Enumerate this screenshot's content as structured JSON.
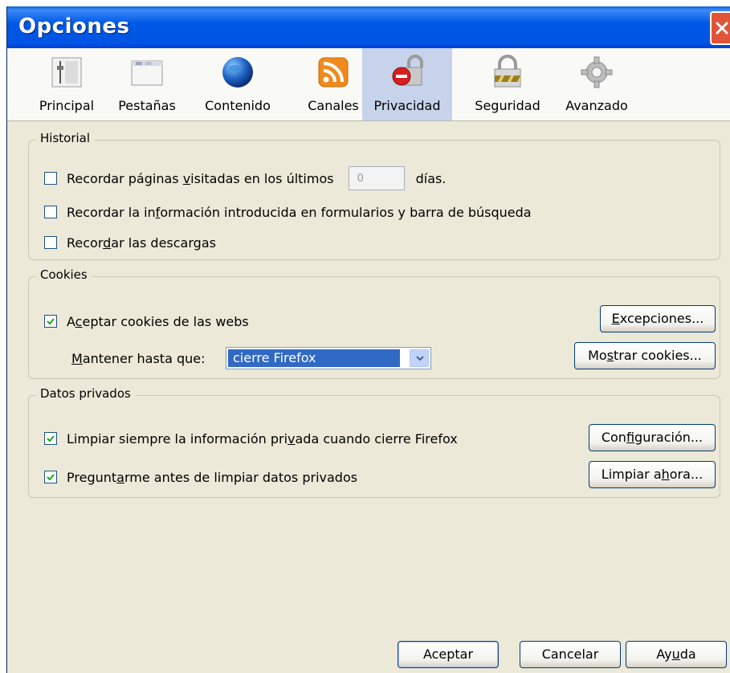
{
  "window": {
    "title": "Opciones"
  },
  "tabs": [
    {
      "label": "Principal",
      "icon": "main-panel-icon",
      "selected": false
    },
    {
      "label": "Pestañas",
      "icon": "tabs-window-icon",
      "selected": false
    },
    {
      "label": "Contenido",
      "icon": "globe-icon",
      "selected": false
    },
    {
      "label": "Canales",
      "icon": "rss-feed-icon",
      "selected": false
    },
    {
      "label": "Privacidad",
      "icon": "privacy-lock-icon",
      "selected": true
    },
    {
      "label": "Seguridad",
      "icon": "security-padlock-icon",
      "selected": false
    },
    {
      "label": "Avanzado",
      "icon": "gear-icon",
      "selected": false
    }
  ],
  "historial": {
    "legend": "Historial",
    "remember_pages": {
      "before": "Recordar páginas ",
      "u": "v",
      "after": "isitadas en los últimos",
      "checked": false
    },
    "days_value": "0",
    "days_label": "días.",
    "remember_forms": {
      "before": "Recordar la in",
      "u": "f",
      "after": "ormación introducida en formularios y barra de búsqueda",
      "checked": false
    },
    "remember_downloads": {
      "before": "Recor",
      "u": "d",
      "after": "ar las descargas",
      "checked": false
    }
  },
  "cookies": {
    "legend": "Cookies",
    "accept": {
      "before": "A",
      "u": "c",
      "after": "eptar cookies de las webs",
      "checked": true
    },
    "keep_label": {
      "before": "",
      "u": "M",
      "after": "antener hasta que:"
    },
    "keep_value": "cierre Firefox",
    "exceptions_button": {
      "before": "",
      "u": "E",
      "after": "xcepciones..."
    },
    "show_cookies_button": {
      "before": "Mo",
      "u": "s",
      "after": "trar cookies..."
    }
  },
  "private_data": {
    "legend": "Datos privados",
    "always_clear": {
      "before": "Limpiar siempre la información pri",
      "u": "v",
      "after": "ada cuando cierre Firefox",
      "checked": true
    },
    "ask_before": {
      "before": "Pregunt",
      "u": "a",
      "after": "rme antes de limpiar datos privados",
      "checked": true
    },
    "settings_button": {
      "before": "Con",
      "u": "f",
      "after": "iguración..."
    },
    "clear_now_button": {
      "before": "Limpiar a",
      "u": "h",
      "after": "ora..."
    }
  },
  "footer": {
    "accept": "Aceptar",
    "cancel": "Cancelar",
    "help": {
      "before": "Ay",
      "u": "u",
      "after": "da"
    }
  },
  "colors": {
    "title_bar": "#0054e3",
    "selected_tab": "#c7d3ea",
    "dialog_bg": "#ece9d8",
    "select_highlight": "#316ac5"
  }
}
